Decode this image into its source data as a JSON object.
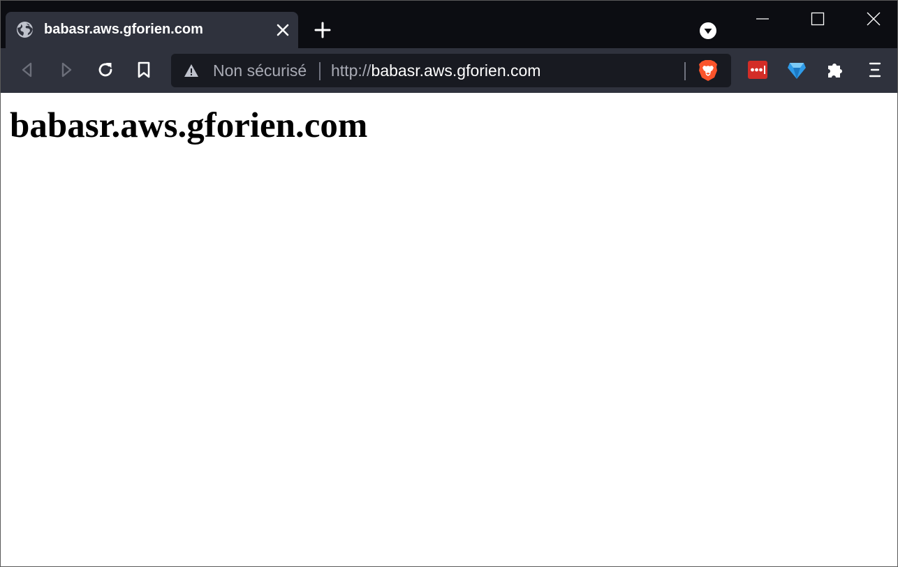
{
  "tab": {
    "title": "babasr.aws.gforien.com",
    "icon": "globe-icon"
  },
  "urlbar": {
    "security_label": "Non sécurisé",
    "scheme": "http://",
    "host": "babasr.aws.gforien.com"
  },
  "page": {
    "heading": "babasr.aws.gforien.com"
  },
  "icons": {
    "back": "back-arrow-icon",
    "forward": "forward-arrow-icon",
    "reload": "reload-icon",
    "bookmark": "bookmark-icon",
    "warning": "warning-icon",
    "brave_shields": "brave-lion-icon",
    "lastpass": "lastpass-icon",
    "gem": "gem-icon",
    "extensions": "puzzle-icon",
    "menu": "menu-icon"
  },
  "colors": {
    "titlebar_bg": "#0c0d12",
    "toolbar_bg": "#2f323d",
    "urlbar_bg": "#181a21",
    "brave_orange": "#fb542b",
    "lastpass_red": "#d32d27",
    "gem_blue": "#2f9be8"
  }
}
